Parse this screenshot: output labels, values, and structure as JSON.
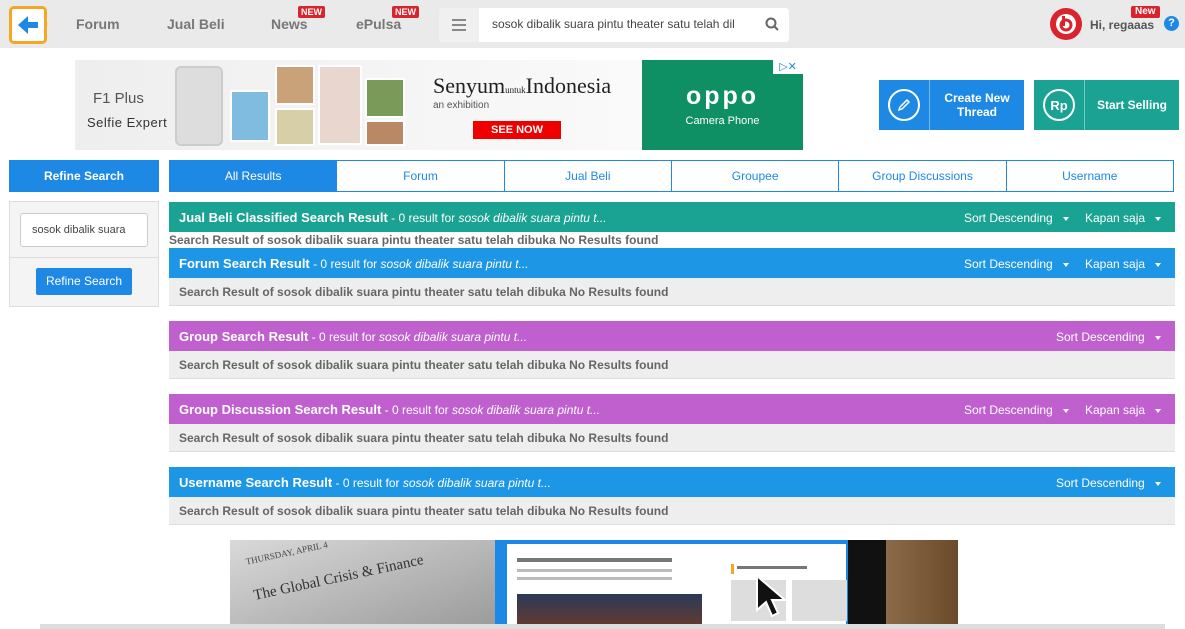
{
  "nav": {
    "links": [
      "Forum",
      "Jual Beli",
      "News",
      "ePulsa"
    ],
    "new_badge": "NEW",
    "search_value": "sosok dibalik suara pintu theater satu telah dil",
    "greeting": "Hi, regaaas",
    "user_new_badge": "New",
    "help_glyph": "?"
  },
  "banner": {
    "model": "F1 Plus",
    "tagline": "Selfie Expert",
    "headline": "Senyum",
    "headline_small": "untuk",
    "headline_end": "Indonesia",
    "subline": "an exhibition",
    "cta": "SEE NOW",
    "brand": "oppo",
    "brand_sub": "Camera Phone"
  },
  "actions": {
    "create_thread": "Create New Thread",
    "rp_icon": "Rp",
    "start_selling": "Start Selling",
    "create_color": "#1e88e5",
    "sell_color": "#1aa393"
  },
  "sidebar": {
    "refine_title": "Refine Search",
    "query": "sosok dibalik suara",
    "refine_button": "Refine Search"
  },
  "tabs": [
    "All Results",
    "Forum",
    "Jual Beli",
    "Groupee",
    "Group Discussions",
    "Username"
  ],
  "sections": [
    {
      "title": "Jual Beli Classified Search Result",
      "count": " - 0 result for ",
      "query": "sosok dibalik suara pintu t...",
      "sort": "Sort Descending",
      "time": "Kapan saja",
      "color": "#1aa393",
      "body": "Search Result of sosok dibalik suara pintu theater satu telah dibuka No Results found"
    },
    {
      "title": "Forum Search Result",
      "count": " - 0 result for ",
      "query": "sosok dibalik suara pintu t...",
      "sort": "Sort Descending",
      "time": "Kapan saja",
      "color": "#1e96e6",
      "body": "Search Result of sosok dibalik suara pintu theater satu telah dibuka No Results found"
    },
    {
      "title": "Group Search Result",
      "count": " - 0 result for ",
      "query": "sosok dibalik suara pintu t...",
      "sort": "Sort Descending",
      "color": "#c060cf",
      "body": "Search Result of sosok dibalik suara pintu theater satu telah dibuka No Results found"
    },
    {
      "title": "Group Discussion Search Result",
      "count": " - 0 result for ",
      "query": "sosok dibalik suara pintu t...",
      "sort": "Sort Descending",
      "time": "Kapan saja",
      "color": "#c060cf",
      "body": "Search Result of sosok dibalik suara pintu theater satu telah dibuka No Results found"
    },
    {
      "title": "Username Search Result",
      "count": " - 0 result for ",
      "query": "sosok dibalik suara pintu t...",
      "sort": "Sort Descending",
      "color": "#1e96e6",
      "body": "Search Result of sosok dibalik suara pintu theater satu telah dibuka No Results found"
    }
  ],
  "bottom_ad": {
    "date": "THURSDAY, APRIL 4",
    "headline": "The Global Crisis & Finance"
  }
}
